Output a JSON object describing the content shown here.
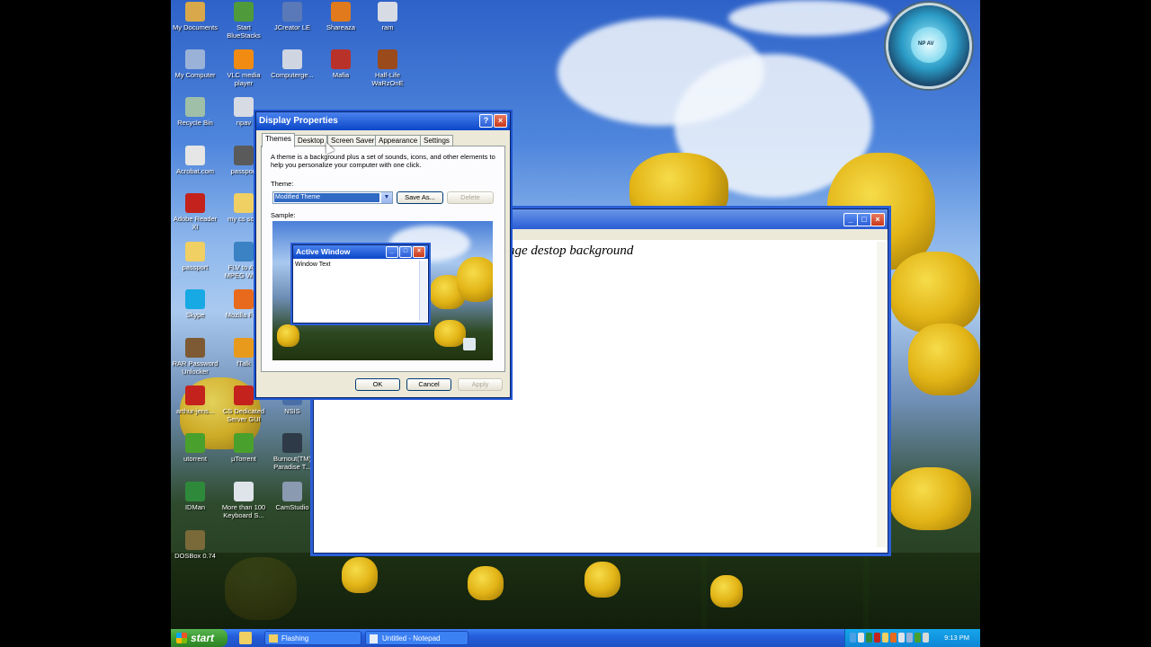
{
  "desktop": {
    "icons": [
      {
        "label": "My Documents",
        "color": "#d9a84a"
      },
      {
        "label": "Start BlueStacks",
        "color": "#4f9a3a"
      },
      {
        "label": "JCreator LE",
        "color": "#5a79b8"
      },
      {
        "label": "Shareaza",
        "color": "#e07a1c"
      },
      {
        "label": "ram",
        "color": "#d7dbe4"
      },
      {
        "label": "My Computer",
        "color": "#9bb2d8"
      },
      {
        "label": "VLC media player",
        "color": "#f28b12"
      },
      {
        "label": "Computerge...",
        "color": "#cfd6e2"
      },
      {
        "label": "Mafia",
        "color": "#b8322a"
      },
      {
        "label": "Half-Life WaRzOnE",
        "color": "#9b4a1c"
      },
      {
        "label": "Recycle Bin",
        "color": "#9fbfa8"
      },
      {
        "label": "npav",
        "color": "#d7dbe4"
      },
      {
        "label": "Acrobat.com",
        "color": "#e6e6e6"
      },
      {
        "label": "passport",
        "color": "#5a5a5a"
      },
      {
        "label": "Adobe Reader XI",
        "color": "#c4221c"
      },
      {
        "label": "my cs scor",
        "color": "#f0cf63"
      },
      {
        "label": "passport",
        "color": "#f0cf63"
      },
      {
        "label": "FLV to AVI MPEG WMA",
        "color": "#3a82c4"
      },
      {
        "label": "Skype",
        "color": "#17a9e4"
      },
      {
        "label": "Mozilla Firef",
        "color": "#e86a1c"
      },
      {
        "label": "RAR Password Unlocker",
        "color": "#7d5a34"
      },
      {
        "label": "fTalk",
        "color": "#e89a1c"
      },
      {
        "label": "arthur-jens...",
        "color": "#c4221c"
      },
      {
        "label": "CS Dedicated Server GUI",
        "color": "#c4221c"
      },
      {
        "label": "NSIS",
        "color": "#4a6fa8"
      },
      {
        "label": "utorrent",
        "color": "#4aa02c"
      },
      {
        "label": "µTorrent",
        "color": "#4aa02c"
      },
      {
        "label": "Burnout(TM) Paradise T...",
        "color": "#2e3a48"
      },
      {
        "label": "IDMan",
        "color": "#2e8a3a"
      },
      {
        "label": "More than 100 Keyboard S...",
        "color": "#dfe3ea"
      },
      {
        "label": "CamStudio",
        "color": "#8a9ab0"
      },
      {
        "label": "DOSBox 0.74",
        "color": "#7a6a3a"
      }
    ]
  },
  "notepad": {
    "content_text": "nge destop background",
    "title_buttons": {
      "minimize": "_",
      "maximize": "□",
      "close": "×"
    }
  },
  "display_properties": {
    "title": "Display Properties",
    "help_button": "?",
    "close_button": "×",
    "tabs": [
      "Themes",
      "Desktop",
      "Screen Saver",
      "Appearance",
      "Settings"
    ],
    "active_tab": "Themes",
    "description": "A theme is a background plus a set of sounds, icons, and other elements to help you personalize your computer with one click.",
    "theme_label": "Theme:",
    "theme_value": "Modified Theme",
    "save_as_label": "Save As...",
    "delete_label": "Delete",
    "sample_label": "Sample:",
    "sample_window": {
      "title": "Active Window",
      "text": "Window Text"
    },
    "ok_label": "OK",
    "cancel_label": "Cancel",
    "apply_label": "Apply"
  },
  "taskbar": {
    "start_label": "start",
    "items": [
      "Flashing",
      "Untitled - Notepad"
    ],
    "clock": "9:13 PM"
  },
  "gadget": {
    "label": "NP AV"
  }
}
